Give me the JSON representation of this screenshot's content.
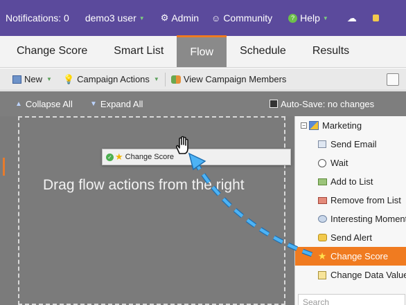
{
  "topbar": {
    "notifications": "Notifications: 0",
    "user": "demo3 user",
    "admin": "Admin",
    "community": "Community",
    "help": "Help"
  },
  "tabs": [
    "Change Score",
    "Smart List",
    "Flow",
    "Schedule",
    "Results"
  ],
  "active_tab": "Flow",
  "toolbar": {
    "new_label": "New",
    "campaign_actions_label": "Campaign Actions",
    "view_members_label": "View Campaign Members"
  },
  "subbar": {
    "collapse_label": "Collapse All",
    "expand_label": "Expand All",
    "autosave_label": "Auto-Save: no changes"
  },
  "canvas": {
    "drop_message": "Drag flow actions from the right",
    "drag_chip_label": "Change Score"
  },
  "panel": {
    "folder": "Marketing",
    "items": [
      {
        "label": "Send Email",
        "icon": "email-icon"
      },
      {
        "label": "Wait",
        "icon": "clock-icon"
      },
      {
        "label": "Add to List",
        "icon": "add-list-icon"
      },
      {
        "label": "Remove from List",
        "icon": "remove-list-icon"
      },
      {
        "label": "Interesting Moment",
        "icon": "speech-bubble-icon"
      },
      {
        "label": "Send Alert",
        "icon": "alert-icon"
      },
      {
        "label": "Change Score",
        "icon": "star-icon",
        "selected": true
      },
      {
        "label": "Change Data Value",
        "icon": "data-value-icon"
      }
    ],
    "search_placeholder": "Search"
  },
  "colors": {
    "topbar": "#5b4a9c",
    "accent": "#f07b20",
    "arrow": "#2f9fe6",
    "canvas": "#7b7b7b"
  }
}
